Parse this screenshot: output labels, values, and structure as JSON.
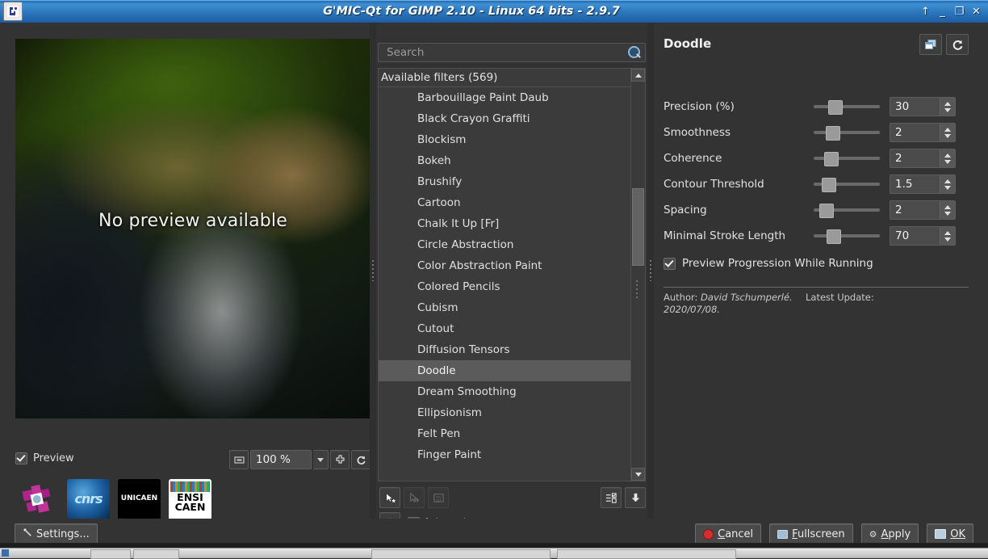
{
  "window": {
    "title": "G'MIC-Qt for GIMP 2.10 - Linux 64 bits - 2.9.7",
    "app_icon": "gmic-logo-icon",
    "controls": [
      {
        "name": "shade-button",
        "glyph": "↑"
      },
      {
        "name": "minimize-button",
        "glyph": "_"
      },
      {
        "name": "maximize-button",
        "glyph": "❐"
      },
      {
        "name": "close-button",
        "glyph": "✕"
      }
    ]
  },
  "preview": {
    "overlay_text": "No preview available",
    "checkbox_label": "Preview",
    "checkbox_checked": true,
    "zoom_value": "100 %",
    "zoom_icon": "fit-view-icon",
    "add_icon": "zoom-in-cross-icon",
    "reset_icon": "reset-rotate-icon"
  },
  "logos": [
    {
      "caption": "GREYC",
      "icon": "greyc-logo"
    },
    {
      "caption": "CNRS",
      "icon": "cnrs-logo",
      "text": "cnrs"
    },
    {
      "caption": "UNICAEN",
      "icon": "unicaen-logo",
      "text": "UNICAEN"
    },
    {
      "caption": "ENSICAEN",
      "icon": "ensicaen-logo",
      "line1": "ENSI",
      "line2": "CAEN"
    }
  ],
  "filters": {
    "search_placeholder": "Search",
    "search_value": "",
    "search_icon": "search-icon",
    "group_header": "Available filters (569)",
    "selected": "Doodle",
    "items": [
      "Barbouillage Paint Daub",
      "Black Crayon Graffiti",
      "Blockism",
      "Bokeh",
      "Brushify",
      "Cartoon",
      "Chalk It Up [Fr]",
      "Circle Abstraction",
      "Color Abstraction Paint",
      "Colored Pencils",
      "Cubism",
      "Cutout",
      "Diffusion Tensors",
      "Doodle",
      "Dream Smoothing",
      "Ellipsionism",
      "Felt Pen",
      "Finger Paint"
    ],
    "toolbar_left": [
      {
        "name": "add-fave-button",
        "icon": "cursor-star-icon",
        "enabled": true
      },
      {
        "name": "add-folder-button",
        "icon": "cursor-plus-icon",
        "enabled": false
      },
      {
        "name": "rename-fave-button",
        "icon": "rename-abc-icon",
        "enabled": false
      }
    ],
    "toolbar_right": [
      {
        "name": "expand-collapse-button",
        "icon": "list-checkbox-icon"
      },
      {
        "name": "download-updates-button",
        "icon": "download-arrow-icon"
      }
    ],
    "refresh_icon": "refresh-icon",
    "internet_label": "Internet",
    "internet_checked": true
  },
  "params": {
    "title": "Doodle",
    "header_buttons": [
      {
        "name": "toggle-panel-button",
        "icon": "window-restore-icon"
      },
      {
        "name": "reset-parameters-button",
        "icon": "reset-rotate-icon"
      }
    ],
    "rows": [
      {
        "label": "Precision (%)",
        "value": "30",
        "handle_pct": 22
      },
      {
        "label": "Smoothness",
        "value": "2",
        "handle_pct": 18
      },
      {
        "label": "Coherence",
        "value": "2",
        "handle_pct": 16
      },
      {
        "label": "Contour Threshold",
        "value": "1.5",
        "handle_pct": 12
      },
      {
        "label": "Spacing",
        "value": "2",
        "handle_pct": 8
      },
      {
        "label": "Minimal Stroke Length",
        "value": "70",
        "handle_pct": 20
      }
    ],
    "checkbox_label": "Preview Progression While Running",
    "checkbox_checked": true,
    "author_prefix": "Author:",
    "author_name": "David Tschumperlé.",
    "update_label": "Latest Update:",
    "update_date": "2020/07/08."
  },
  "bottom": {
    "settings_label": "Settings...",
    "settings_icon": "wrench-icon",
    "buttons": [
      {
        "name": "cancel-button",
        "label": "Cancel",
        "accel": "C",
        "icon": "red-dot-icon"
      },
      {
        "name": "fullscreen-button",
        "label": "Fullscreen",
        "accel": "F",
        "icon": "monitor-icon"
      },
      {
        "name": "apply-button",
        "label": "Apply",
        "accel": "A",
        "icon": "gear-icon"
      },
      {
        "name": "ok-button",
        "label": "OK",
        "accel": "OK",
        "icon": "apply-monitor-icon"
      }
    ]
  },
  "colors": {
    "titlebar_accent": "#2e78bd",
    "background": "#333333",
    "panel": "#3b3b3b",
    "selection": "#5b5b5b",
    "cancel_red": "#d22f2f"
  }
}
